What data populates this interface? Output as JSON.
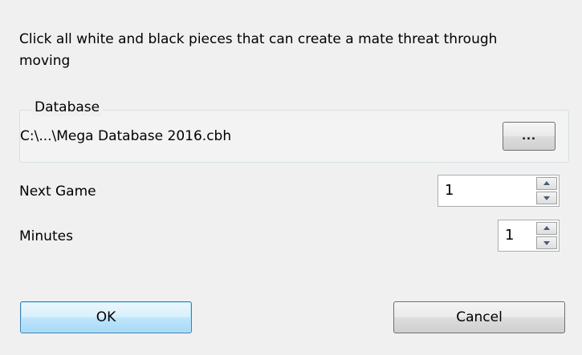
{
  "dialog": {
    "instructions": "Click all white and black pieces that can create a mate threat through moving"
  },
  "database": {
    "group_title": "Database",
    "path": "C:\\...\\Mega Database 2016.cbh",
    "browse_label": "..."
  },
  "next_game": {
    "label": "Next Game",
    "value": "1"
  },
  "minutes": {
    "label": "Minutes",
    "value": "1"
  },
  "buttons": {
    "ok": "OK",
    "cancel": "Cancel"
  },
  "icons": {
    "spin_up": "spin-up-arrow-icon",
    "spin_down": "spin-down-arrow-icon"
  }
}
